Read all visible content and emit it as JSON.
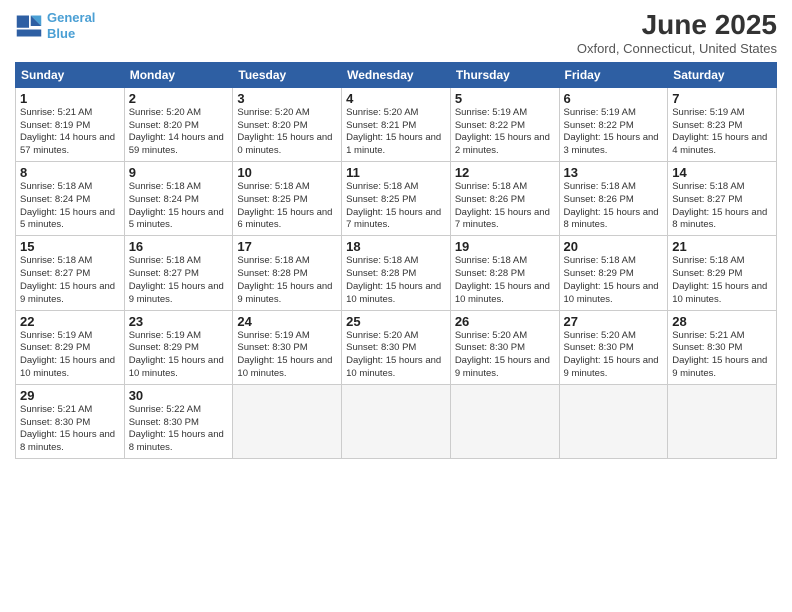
{
  "header": {
    "logo_line1": "General",
    "logo_line2": "Blue",
    "title": "June 2025",
    "subtitle": "Oxford, Connecticut, United States"
  },
  "days_of_week": [
    "Sunday",
    "Monday",
    "Tuesday",
    "Wednesday",
    "Thursday",
    "Friday",
    "Saturday"
  ],
  "weeks": [
    [
      {
        "num": "1",
        "sr": "5:21 AM",
        "ss": "8:19 PM",
        "dl": "14 hours and 57 minutes."
      },
      {
        "num": "2",
        "sr": "5:20 AM",
        "ss": "8:20 PM",
        "dl": "14 hours and 59 minutes."
      },
      {
        "num": "3",
        "sr": "5:20 AM",
        "ss": "8:20 PM",
        "dl": "15 hours and 0 minutes."
      },
      {
        "num": "4",
        "sr": "5:20 AM",
        "ss": "8:21 PM",
        "dl": "15 hours and 1 minute."
      },
      {
        "num": "5",
        "sr": "5:19 AM",
        "ss": "8:22 PM",
        "dl": "15 hours and 2 minutes."
      },
      {
        "num": "6",
        "sr": "5:19 AM",
        "ss": "8:22 PM",
        "dl": "15 hours and 3 minutes."
      },
      {
        "num": "7",
        "sr": "5:19 AM",
        "ss": "8:23 PM",
        "dl": "15 hours and 4 minutes."
      }
    ],
    [
      {
        "num": "8",
        "sr": "5:18 AM",
        "ss": "8:24 PM",
        "dl": "15 hours and 5 minutes."
      },
      {
        "num": "9",
        "sr": "5:18 AM",
        "ss": "8:24 PM",
        "dl": "15 hours and 5 minutes."
      },
      {
        "num": "10",
        "sr": "5:18 AM",
        "ss": "8:25 PM",
        "dl": "15 hours and 6 minutes."
      },
      {
        "num": "11",
        "sr": "5:18 AM",
        "ss": "8:25 PM",
        "dl": "15 hours and 7 minutes."
      },
      {
        "num": "12",
        "sr": "5:18 AM",
        "ss": "8:26 PM",
        "dl": "15 hours and 7 minutes."
      },
      {
        "num": "13",
        "sr": "5:18 AM",
        "ss": "8:26 PM",
        "dl": "15 hours and 8 minutes."
      },
      {
        "num": "14",
        "sr": "5:18 AM",
        "ss": "8:27 PM",
        "dl": "15 hours and 8 minutes."
      }
    ],
    [
      {
        "num": "15",
        "sr": "5:18 AM",
        "ss": "8:27 PM",
        "dl": "15 hours and 9 minutes."
      },
      {
        "num": "16",
        "sr": "5:18 AM",
        "ss": "8:27 PM",
        "dl": "15 hours and 9 minutes."
      },
      {
        "num": "17",
        "sr": "5:18 AM",
        "ss": "8:28 PM",
        "dl": "15 hours and 9 minutes."
      },
      {
        "num": "18",
        "sr": "5:18 AM",
        "ss": "8:28 PM",
        "dl": "15 hours and 10 minutes."
      },
      {
        "num": "19",
        "sr": "5:18 AM",
        "ss": "8:28 PM",
        "dl": "15 hours and 10 minutes."
      },
      {
        "num": "20",
        "sr": "5:18 AM",
        "ss": "8:29 PM",
        "dl": "15 hours and 10 minutes."
      },
      {
        "num": "21",
        "sr": "5:18 AM",
        "ss": "8:29 PM",
        "dl": "15 hours and 10 minutes."
      }
    ],
    [
      {
        "num": "22",
        "sr": "5:19 AM",
        "ss": "8:29 PM",
        "dl": "15 hours and 10 minutes."
      },
      {
        "num": "23",
        "sr": "5:19 AM",
        "ss": "8:29 PM",
        "dl": "15 hours and 10 minutes."
      },
      {
        "num": "24",
        "sr": "5:19 AM",
        "ss": "8:30 PM",
        "dl": "15 hours and 10 minutes."
      },
      {
        "num": "25",
        "sr": "5:20 AM",
        "ss": "8:30 PM",
        "dl": "15 hours and 10 minutes."
      },
      {
        "num": "26",
        "sr": "5:20 AM",
        "ss": "8:30 PM",
        "dl": "15 hours and 9 minutes."
      },
      {
        "num": "27",
        "sr": "5:20 AM",
        "ss": "8:30 PM",
        "dl": "15 hours and 9 minutes."
      },
      {
        "num": "28",
        "sr": "5:21 AM",
        "ss": "8:30 PM",
        "dl": "15 hours and 9 minutes."
      }
    ],
    [
      {
        "num": "29",
        "sr": "5:21 AM",
        "ss": "8:30 PM",
        "dl": "15 hours and 8 minutes."
      },
      {
        "num": "30",
        "sr": "5:22 AM",
        "ss": "8:30 PM",
        "dl": "15 hours and 8 minutes."
      },
      null,
      null,
      null,
      null,
      null
    ]
  ]
}
